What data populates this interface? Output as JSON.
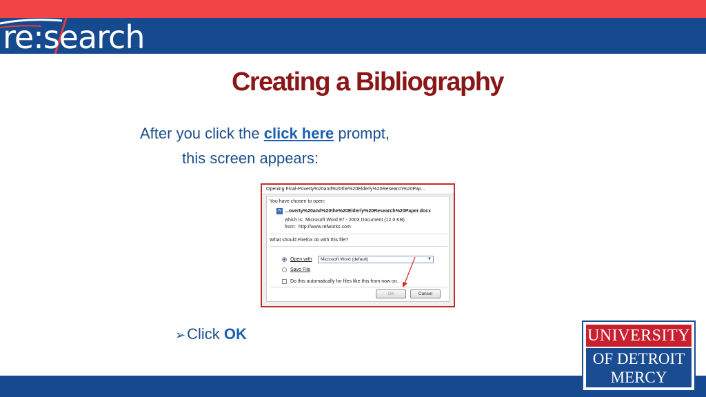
{
  "header": {
    "logo_text": "re:search"
  },
  "slide": {
    "title": "Creating a Bibliography",
    "intro_before": "After you click the ",
    "intro_link": "click here",
    "intro_after": " prompt,",
    "intro_line2": "this screen appears:",
    "bullet_prefix": "Click ",
    "bullet_bold": "OK"
  },
  "dialog": {
    "title": "Opening Final-Poverty%20and%20the%20Elderly%20Research%20Pap...",
    "chosen_label": "You have chosen to open:",
    "file_name": "...overty%20and%20the%20Elderly%20Research%20Paper.docx",
    "which_is_label": "which is:",
    "which_is_value": "Microsoft Word 97 - 2003 Document (12.0 KB)",
    "from_label": "from:",
    "from_value": "http://www.refworks.com",
    "question": "What should Firefox do with this file?",
    "open_with_label": "Open with",
    "open_with_value": "Microsoft Word (default)",
    "save_file_label": "Save File",
    "auto_label": "Do this automatically for files like this from now on.",
    "ok_label": "OK",
    "cancel_label": "Cancel"
  },
  "footer_logo": {
    "line1": "UNIVERSITY",
    "line2": "OF DETROIT",
    "line3": "MERCY"
  },
  "colors": {
    "top_red": "#f24447",
    "brand_blue": "#164a8f",
    "title_red": "#8a1616",
    "text_blue": "#1c4f8c"
  }
}
